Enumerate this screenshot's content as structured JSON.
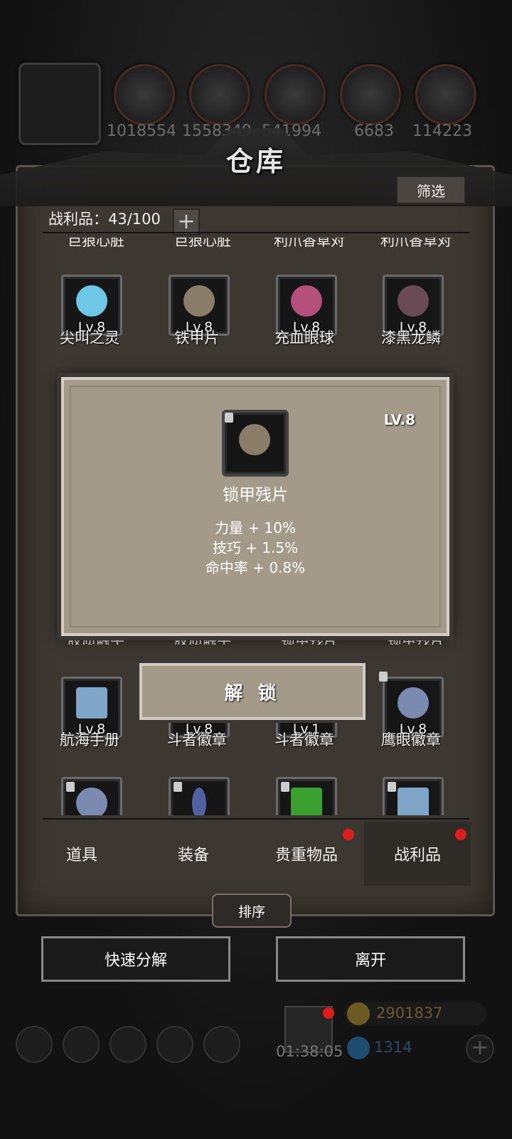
{
  "title": "仓库",
  "filter_label": "筛选",
  "loot_count_label": "战利品：43/100",
  "plus_symbol": "+",
  "resources": [
    "1018554",
    "1558349",
    "541994",
    "6683",
    "114223"
  ],
  "top_cut_names": [
    "巨狼心脏",
    "巨狼心脏",
    "利爪香草对",
    "利爪香草对"
  ],
  "row1": [
    {
      "level": "Lv.8",
      "name": "尖叫之灵",
      "color": "#6fc7e8"
    },
    {
      "level": "Lv.8",
      "name": "铁甲片",
      "color": "#8a7d6a"
    },
    {
      "level": "Lv.8",
      "name": "充血眼球",
      "color": "#b5507a"
    },
    {
      "level": "Lv.8",
      "name": "漆黑龙鳞",
      "color": "#6a4a55"
    }
  ],
  "hidden_names": [
    "胶质触手",
    "胶质触手",
    "锁甲残片",
    "锁甲残片"
  ],
  "row3": [
    {
      "level": "Lv.8",
      "name": "航海手册",
      "color": "#7fa6c8"
    },
    {
      "level": "Lv.8",
      "name": "斗者徽章",
      "color": "#555"
    },
    {
      "level": "Lv.1",
      "name": "斗者徽章",
      "color": "#555"
    },
    {
      "level": "Lv.8",
      "name": "鹰眼徽章",
      "color": "#7a8ab0"
    }
  ],
  "popup": {
    "level": "LV.8",
    "name": "锁甲残片",
    "stats": [
      "力量 + 10%",
      "技巧 + 1.5%",
      "命中率 + 0.8%"
    ]
  },
  "unlock_label": "解 锁",
  "tabs": [
    "道具",
    "装备",
    "贵重物品",
    "战利品"
  ],
  "sort_label": "排序",
  "quick_decompose_label": "快速分解",
  "leave_label": "离开",
  "timer": "01:38:05",
  "gold": "2901837",
  "gems": "1314"
}
